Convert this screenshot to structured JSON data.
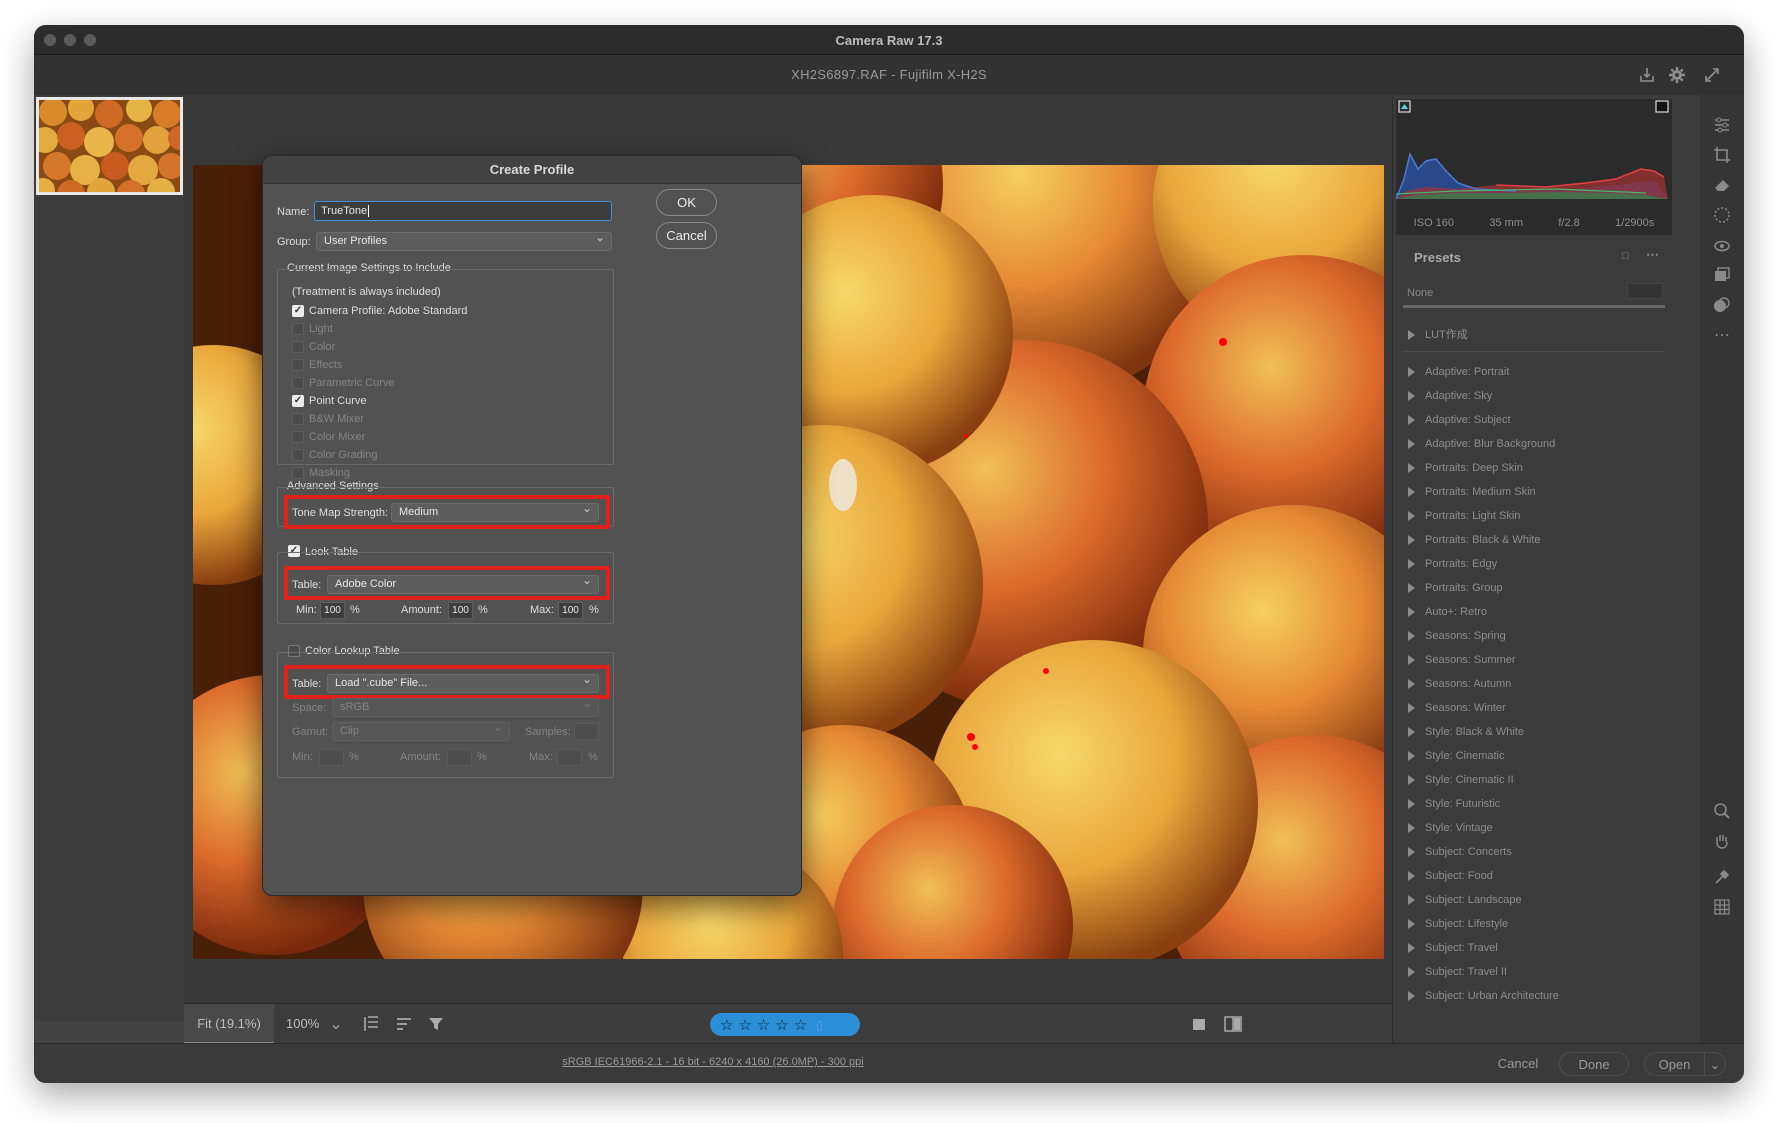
{
  "window": {
    "app_title": "Camera Raw 17.3",
    "file_info": "XH2S6897.RAF  -  Fujifilm X-H2S"
  },
  "icons": {
    "export": "save-icon",
    "settings": "gear-icon",
    "fullscreen": "expand-icon"
  },
  "exif": {
    "iso": "ISO 160",
    "focal": "35 mm",
    "aperture": "f/2.8",
    "shutter": "1/2900s"
  },
  "presets": {
    "title": "Presets",
    "none_label": "None",
    "items": [
      "LUT作成",
      "Adaptive: Portrait",
      "Adaptive: Sky",
      "Adaptive: Subject",
      "Adaptive: Blur Background",
      "Portraits: Deep Skin",
      "Portraits: Medium Skin",
      "Portraits: Light Skin",
      "Portraits: Black & White",
      "Portraits: Edgy",
      "Portraits: Group",
      "Auto+: Retro",
      "Seasons: Spring",
      "Seasons: Summer",
      "Seasons: Autumn",
      "Seasons: Winter",
      "Style: Black & White",
      "Style: Cinematic",
      "Style: Cinematic II",
      "Style: Futuristic",
      "Style: Vintage",
      "Subject: Concerts",
      "Subject: Food",
      "Subject: Landscape",
      "Subject: Lifestyle",
      "Subject: Travel",
      "Subject: Travel II",
      "Subject: Urban Architecture"
    ]
  },
  "bottom_toolbar": {
    "fit": "Fit (19.1%)",
    "zoom": "100%"
  },
  "status": {
    "info": "sRGB IEC61966-2.1 - 16 bit - 6240 x 4160 (26.0MP) - 300 ppi",
    "cancel": "Cancel",
    "done": "Done",
    "open": "Open"
  },
  "dialog": {
    "title": "Create Profile",
    "name_label": "Name:",
    "name_value": "TrueTone",
    "group_label": "Group:",
    "group_value": "User Profiles",
    "ok": "OK",
    "cancel": "Cancel",
    "settings_title": "Current Image Settings to Include",
    "treatment_note": "(Treatment is always included)",
    "settings": [
      {
        "label": "Camera Profile: Adobe Standard",
        "checked": true
      },
      {
        "label": "Light",
        "checked": false
      },
      {
        "label": "Color",
        "checked": false
      },
      {
        "label": "Effects",
        "checked": false
      },
      {
        "label": "Parametric Curve",
        "checked": false
      },
      {
        "label": "Point Curve",
        "checked": true
      },
      {
        "label": "B&W Mixer",
        "checked": false
      },
      {
        "label": "Color Mixer",
        "checked": false
      },
      {
        "label": "Color Grading",
        "checked": false
      },
      {
        "label": "Masking",
        "checked": false
      }
    ],
    "advanced_title": "Advanced Settings",
    "tone_map_label": "Tone Map Strength:",
    "tone_map_value": "Medium",
    "look_table_label": "Look Table",
    "table_label": "Table:",
    "look_table_value": "Adobe Color",
    "min_label": "Min:",
    "min_value": "100",
    "amount_label": "Amount:",
    "amount_value": "100",
    "max_label": "Max:",
    "max_value": "100",
    "percent": "%",
    "clut_label": "Color Lookup Table",
    "clut_table_value": "Load \".cube\" File...",
    "space_label": "Space:",
    "space_value": "sRGB",
    "gamut_label": "Gamut:",
    "gamut_value": "Clip",
    "samples_label": "Samples:"
  },
  "colors": {
    "highlight": "#e0211b",
    "rating_bar": "#2a8fd6"
  }
}
